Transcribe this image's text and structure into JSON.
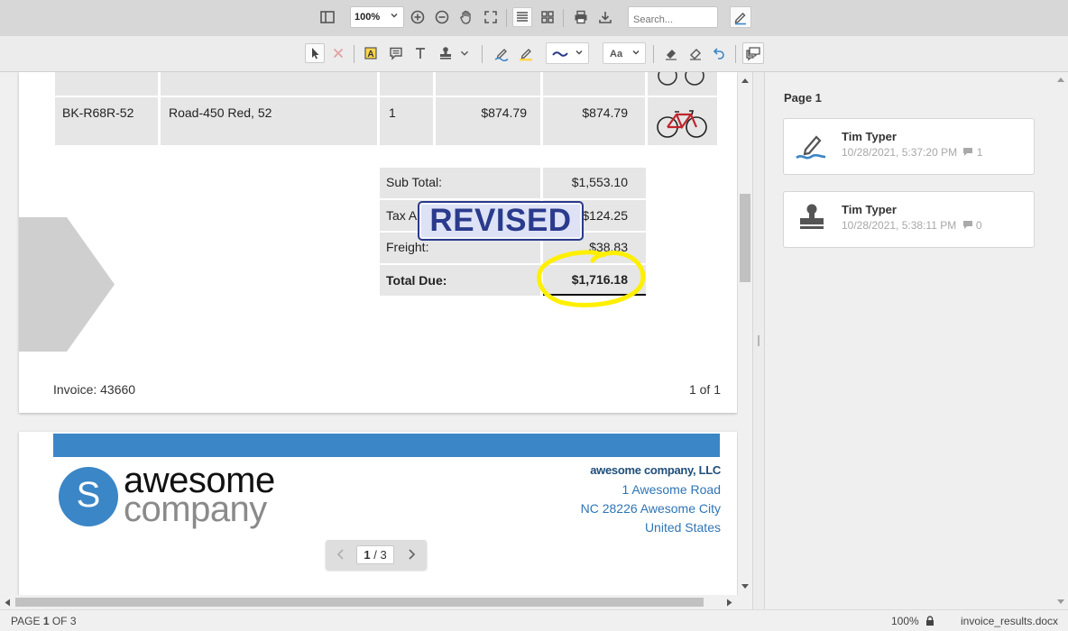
{
  "toolbar": {
    "zoom_value": "100%",
    "search_placeholder": "Search..."
  },
  "invoice": {
    "line_item": {
      "sku": "BK-R68R-52",
      "product": "Road-450 Red, 52",
      "qty": "1",
      "unit_price": "$874.79",
      "line_total": "$874.79"
    },
    "totals": [
      {
        "label": "Sub Total:",
        "value": "$1,553.10"
      },
      {
        "label": "Tax A",
        "value": "$124.25"
      },
      {
        "label": "Freight:",
        "value": "$38.83"
      },
      {
        "label": "Total Due:",
        "value": "$1,716.18"
      }
    ],
    "stamp_text": "REVISED",
    "footer_left": "Invoice: 43660",
    "footer_right": "1 of 1"
  },
  "page2": {
    "logo_letter": "S",
    "logo_word1": "awesome",
    "logo_word2": "company",
    "company_name": "awesome company, LLC",
    "address_line1": "1 Awesome Road",
    "address_line2": "NC 28226 Awesome City",
    "address_line3": "United States"
  },
  "pager": {
    "current": "1",
    "separator": "/",
    "total": "3"
  },
  "panel": {
    "title": "Page 1",
    "annotations": [
      {
        "author": "Tim Typer",
        "timestamp": "10/28/2021, 5:37:20 PM",
        "replies": "1",
        "icon": "signature-icon"
      },
      {
        "author": "Tim Typer",
        "timestamp": "10/28/2021, 5:38:11 PM",
        "replies": "0",
        "icon": "stamp-icon"
      }
    ]
  },
  "status": {
    "page_prefix": "PAGE",
    "page_current": "1",
    "page_of": "OF",
    "page_total": "3",
    "zoom": "100%",
    "filename": "invoice_results.docx"
  },
  "colors": {
    "accent_blue": "#3b86c6",
    "stamp_navy": "#2a3a8c",
    "highlight_yellow": "#ffef00",
    "panel_bg": "#efefef"
  }
}
